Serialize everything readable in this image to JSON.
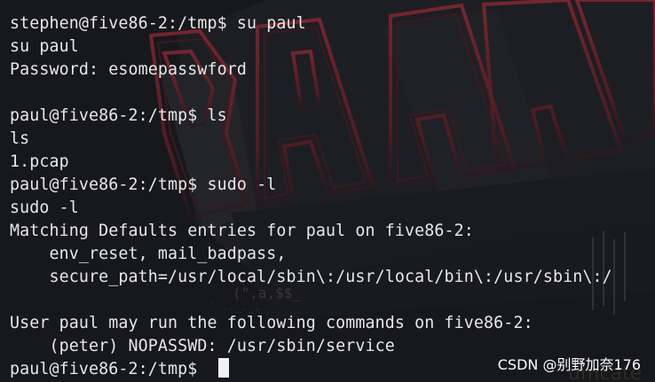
{
  "terminal": {
    "lines": [
      "stephen@five86-2:/tmp$ su paul",
      "su paul",
      "Password: esomepasswford",
      "",
      "paul@five86-2:/tmp$ ls",
      "ls",
      "1.pcap",
      "paul@five86-2:/tmp$ sudo -l",
      "sudo -l",
      "Matching Defaults entries for paul on five86-2:",
      "    env_reset, mail_badpass,",
      "    secure_path=/usr/local/sbin\\:/usr/local/bin\\:/usr/sbin\\:/",
      "",
      "User paul may run the following commands on five86-2:",
      "    (peter) NOPASSWD: /usr/sbin/service",
      "paul@five86-2:/tmp$ "
    ]
  },
  "watermark": "CSDN @别野加奈176",
  "colors": {
    "background": "#17181c",
    "text": "#e8e8e8",
    "art_red": "#5e1f26"
  }
}
